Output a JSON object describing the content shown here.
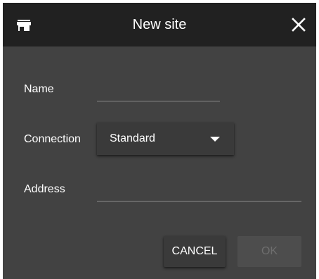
{
  "dialog": {
    "title": "New site",
    "icon": "storefront-icon",
    "close_icon": "close-icon"
  },
  "form": {
    "name_label": "Name",
    "name_value": "",
    "connection_label": "Connection",
    "connection_value": "Standard",
    "address_label": "Address",
    "address_value": ""
  },
  "actions": {
    "cancel_label": "CANCEL",
    "ok_label": "OK",
    "ok_enabled": false
  },
  "colors": {
    "titlebar_bg": "#212121",
    "dialog_bg": "#424242",
    "text": "#ffffff",
    "disabled_text": "#6e6e6e"
  }
}
